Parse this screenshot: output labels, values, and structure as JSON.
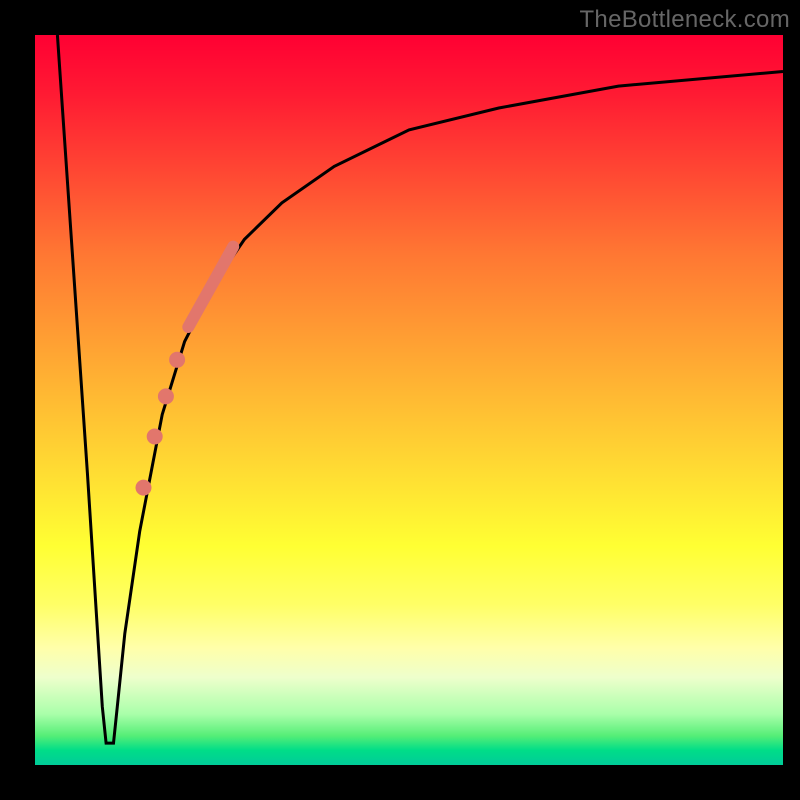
{
  "watermark": "TheBottleneck.com",
  "chart_data": {
    "type": "line",
    "title": "",
    "xlabel": "",
    "ylabel": "",
    "xlim": [
      0,
      100
    ],
    "ylim": [
      0,
      100
    ],
    "grid": false,
    "legend": false,
    "background_gradient": {
      "top_color": "#ff0033",
      "bottom_color": "#00cc99",
      "description": "vertical red-to-green gradient (bottleneck severity heatmap)"
    },
    "series": [
      {
        "name": "bottleneck-curve",
        "color": "#000000",
        "stroke_width": 3,
        "x": [
          3,
          5,
          7,
          9,
          9.5,
          10,
          10.5,
          11,
          12,
          14,
          17,
          20,
          24,
          28,
          33,
          40,
          50,
          62,
          78,
          100
        ],
        "y": [
          100,
          70,
          40,
          8,
          3,
          3,
          3,
          8,
          18,
          32,
          48,
          58,
          66,
          72,
          77,
          82,
          87,
          90,
          93,
          95
        ]
      }
    ],
    "highlight_band": {
      "name": "highlighted-range",
      "color": "#e2766c",
      "stroke_width": 12,
      "x": [
        20.5,
        26.5
      ],
      "y": [
        60,
        71
      ],
      "description": "thick salmon segment along curve"
    },
    "highlight_points": {
      "name": "highlighted-dots",
      "color": "#e2766c",
      "radius": 8,
      "points": [
        {
          "x": 19.0,
          "y": 55.5
        },
        {
          "x": 17.5,
          "y": 50.5
        },
        {
          "x": 16.0,
          "y": 45.0
        },
        {
          "x": 14.5,
          "y": 38.0
        }
      ]
    }
  }
}
